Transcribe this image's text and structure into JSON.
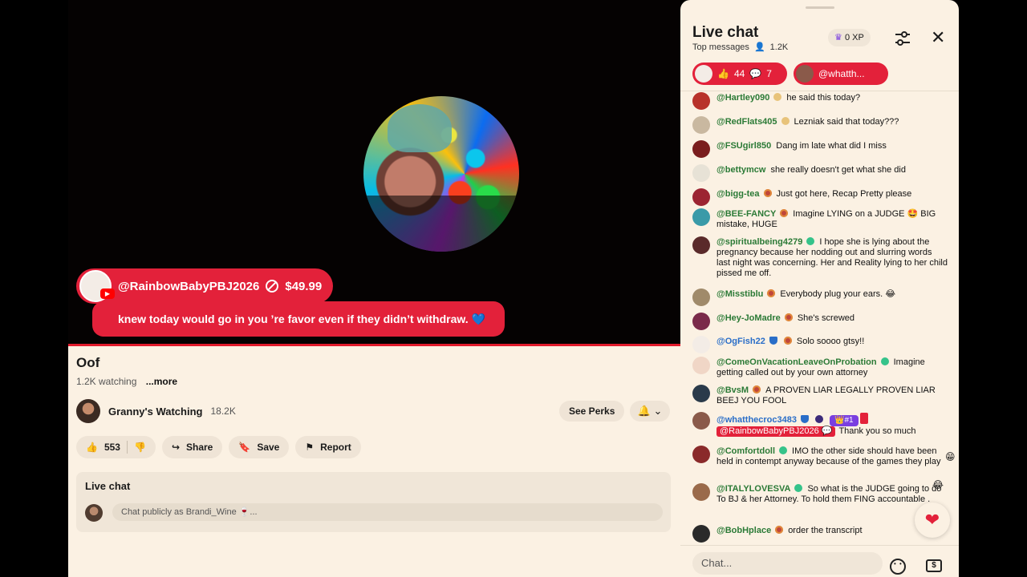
{
  "video": {
    "title": "Oof",
    "watching": "1.2K watching",
    "more": "...more",
    "progress": 1.0,
    "superchat": {
      "author": "@RainbowBabyPBJ2026",
      "amount": "$49.99",
      "message": "knew today would go in you ’re favor even if they didn’t withdraw. 💙"
    }
  },
  "channel": {
    "name": "Granny's Watching",
    "subs": "18.2K",
    "see_perks": "See Perks",
    "bell": "🔔"
  },
  "actions": {
    "likes": "553",
    "share": "Share",
    "save": "Save",
    "report": "Report"
  },
  "livechat_box": {
    "title": "Live chat",
    "placeholder": "Chat publicly as Brandi_Wine 🍷..."
  },
  "chat": {
    "title": "Live chat",
    "mode": "Top messages",
    "viewers": "1.2K",
    "xp": "0 XP",
    "pinned": [
      {
        "likes": "44",
        "replies": "7"
      },
      {
        "label": "@whatth..."
      }
    ],
    "messages": [
      {
        "author": "@Hartley090",
        "badge": "b-gold",
        "text": "he said this today?",
        "avatar": "#b8322a"
      },
      {
        "author": "@RedFlats405",
        "badge": "b-gold",
        "text": "Lezniak said that today???",
        "avatar": "#c9b8a0"
      },
      {
        "author": "@FSUgirl850",
        "badge": "",
        "text": "Dang im late what did I miss",
        "avatar": "#7a1d1d"
      },
      {
        "author": "@bettymcw",
        "badge": "",
        "text": "she really doesn't get what she did",
        "avatar": "#e7e2d6"
      },
      {
        "author": "@bigg-tea",
        "badge": "b-mem",
        "text": "Just got here, Recap Pretty please",
        "avatar": "#9c2432"
      },
      {
        "author": "@BEE-FANCY",
        "badge": "b-mem",
        "text": "Imagine LYING on a JUDGE 🤩 BIG mistake, HUGE",
        "avatar": "#3a9aa8"
      },
      {
        "author": "@spiritualbeing4279",
        "badge": "b-new",
        "text": "I hope she is lying about the pregnancy because her nodding out and slurring words last night was concerning. Her and Reality lying to her child pissed me off.",
        "avatar": "#5a2a2a"
      },
      {
        "author": "@Misstiblu",
        "badge": "b-mem",
        "text": "Everybody plug your ears. 😂",
        "avatar": "#a08a6a"
      },
      {
        "author": "@Hey-JoMadre",
        "badge": "b-mem",
        "text": "She's screwed",
        "avatar": "#7a2a4a"
      },
      {
        "author": "@OgFish22",
        "badge": "b-mod",
        "badge2": "b-mem",
        "text": "Solo soooo gtsy!!",
        "avatar": "#f3ece6",
        "blue": true
      },
      {
        "author": "@ComeOnVacationLeaveOnProbation",
        "badge": "b-new",
        "text": "Imagine getting called out by your own attorney",
        "avatar": "#f0d6c6"
      },
      {
        "author": "@BvsM",
        "badge": "b-mem",
        "text": "A PROVEN LIAR LEGALLY PROVEN LIAR BEEJ YOU FOOL",
        "avatar": "#2a3a4a"
      },
      {
        "author": "@whatthecroc3483",
        "badge": "b-mod",
        "badge2": "b-star",
        "gift": "👑#1",
        "mention": "@RainbowBabyPBJ2026 💬",
        "text": "Thank you so much",
        "avatar": "#8a5a4a",
        "blue": true
      },
      {
        "author": "@Comfortdoll",
        "badge": "b-new",
        "text": "IMO the other side should have been held in contempt anyway because of the games they play",
        "avatar": "#8a2a2a"
      },
      {
        "author": "@ITALYLOVESVA",
        "badge": "b-new",
        "text": "So what is the JUDGE going to do To BJ & her Attorney. To hold them FING accountable .",
        "avatar": "#9a6a4a"
      },
      {
        "author": "@BobHplace",
        "badge": "b-mem",
        "text": "order the transcript",
        "avatar": "#2a2a2a"
      }
    ],
    "input_placeholder": "Chat..."
  }
}
